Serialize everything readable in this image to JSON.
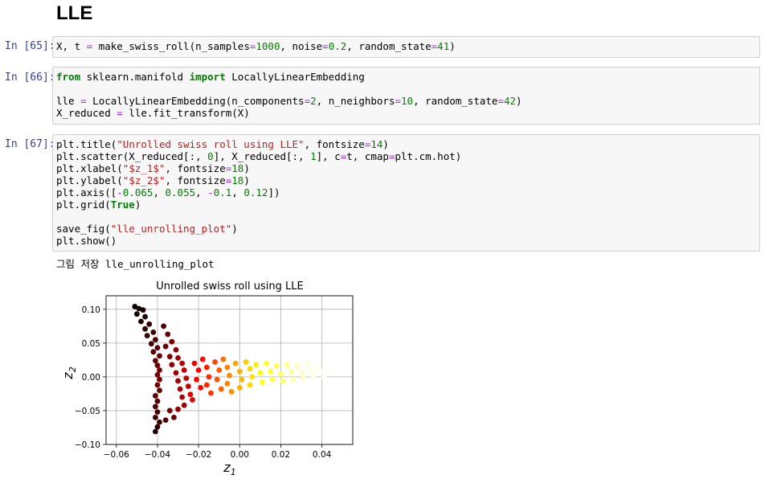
{
  "heading": "LLE",
  "cells": [
    {
      "prompt": "In [65]:",
      "lines": [
        [
          [
            "t",
            "X, t "
          ],
          [
            "op",
            "="
          ],
          [
            "t",
            " make_swiss_roll(n_samples"
          ],
          [
            "op",
            "="
          ],
          [
            "num",
            "1000"
          ],
          [
            "t",
            ", noise"
          ],
          [
            "op",
            "="
          ],
          [
            "num",
            "0.2"
          ],
          [
            "t",
            ", random_state"
          ],
          [
            "op",
            "="
          ],
          [
            "num",
            "41"
          ],
          [
            "t",
            ")"
          ]
        ]
      ]
    },
    {
      "prompt": "In [66]:",
      "lines": [
        [
          [
            "kw",
            "from"
          ],
          [
            "t",
            " sklearn.manifold "
          ],
          [
            "kw",
            "import"
          ],
          [
            "t",
            " LocallyLinearEmbedding"
          ]
        ],
        [],
        [
          [
            "t",
            "lle "
          ],
          [
            "op",
            "="
          ],
          [
            "t",
            " LocallyLinearEmbedding(n_components"
          ],
          [
            "op",
            "="
          ],
          [
            "num",
            "2"
          ],
          [
            "t",
            ", n_neighbors"
          ],
          [
            "op",
            "="
          ],
          [
            "num",
            "10"
          ],
          [
            "t",
            ", random_state"
          ],
          [
            "op",
            "="
          ],
          [
            "num",
            "42"
          ],
          [
            "t",
            ")"
          ]
        ],
        [
          [
            "t",
            "X_reduced "
          ],
          [
            "op",
            "="
          ],
          [
            "t",
            " lle.fit_transform(X)"
          ]
        ]
      ]
    },
    {
      "prompt": "In [67]:",
      "lines": [
        [
          [
            "t",
            "plt.title("
          ],
          [
            "str",
            "\"Unrolled swiss roll using LLE\""
          ],
          [
            "t",
            ", fontsize"
          ],
          [
            "op",
            "="
          ],
          [
            "num",
            "14"
          ],
          [
            "t",
            ")"
          ]
        ],
        [
          [
            "t",
            "plt.scatter(X_reduced[:, "
          ],
          [
            "num",
            "0"
          ],
          [
            "t",
            "], X_reduced[:, "
          ],
          [
            "num",
            "1"
          ],
          [
            "t",
            "], c"
          ],
          [
            "op",
            "="
          ],
          [
            "t",
            "t, cmap"
          ],
          [
            "op",
            "="
          ],
          [
            "t",
            "plt.cm.hot)"
          ]
        ],
        [
          [
            "t",
            "plt.xlabel("
          ],
          [
            "str",
            "\"$z_1$\""
          ],
          [
            "t",
            ", fontsize"
          ],
          [
            "op",
            "="
          ],
          [
            "num",
            "18"
          ],
          [
            "t",
            ")"
          ]
        ],
        [
          [
            "t",
            "plt.ylabel("
          ],
          [
            "str",
            "\"$z_2$\""
          ],
          [
            "t",
            ", fontsize"
          ],
          [
            "op",
            "="
          ],
          [
            "num",
            "18"
          ],
          [
            "t",
            ")"
          ]
        ],
        [
          [
            "t",
            "plt.axis(["
          ],
          [
            "op",
            "-"
          ],
          [
            "num",
            "0.065"
          ],
          [
            "t",
            ", "
          ],
          [
            "num",
            "0.055"
          ],
          [
            "t",
            ", "
          ],
          [
            "op",
            "-"
          ],
          [
            "num",
            "0.1"
          ],
          [
            "t",
            ", "
          ],
          [
            "num",
            "0.12"
          ],
          [
            "t",
            "])"
          ]
        ],
        [
          [
            "t",
            "plt.grid("
          ],
          [
            "kw",
            "True"
          ],
          [
            "t",
            ")"
          ]
        ],
        [],
        [
          [
            "t",
            "save_fig("
          ],
          [
            "str",
            "\"lle_unrolling_plot\""
          ],
          [
            "t",
            ")"
          ]
        ],
        [
          [
            "t",
            "plt.show()"
          ]
        ]
      ]
    }
  ],
  "stdout": "그림 저장 lle_unrolling_plot",
  "chart_data": {
    "type": "scatter",
    "title": "Unrolled swiss roll using LLE",
    "xlabel": "z1",
    "ylabel": "z2",
    "xlim": [
      -0.065,
      0.055
    ],
    "ylim": [
      -0.1,
      0.12
    ],
    "xticks": [
      -0.06,
      -0.04,
      -0.02,
      0.0,
      0.02,
      0.04
    ],
    "xtick_labels": [
      "−0.06",
      "−0.04",
      "−0.02",
      "0.00",
      "0.02",
      "0.04"
    ],
    "yticks": [
      0.1,
      0.05,
      0.0,
      -0.05,
      -0.1
    ],
    "ytick_labels": [
      "0.10",
      "0.05",
      "0.00",
      "−0.05",
      "−0.10"
    ],
    "grid": true,
    "colormap": "hot",
    "points": [
      [
        -0.051,
        0.104,
        0.0
      ],
      [
        -0.049,
        0.101,
        0.01
      ],
      [
        -0.047,
        0.099,
        0.02
      ],
      [
        -0.05,
        0.093,
        0.01
      ],
      [
        -0.046,
        0.089,
        0.03
      ],
      [
        -0.048,
        0.082,
        0.03
      ],
      [
        -0.044,
        0.078,
        0.05
      ],
      [
        -0.046,
        0.071,
        0.05
      ],
      [
        -0.042,
        0.066,
        0.07
      ],
      [
        -0.045,
        0.061,
        0.06
      ],
      [
        -0.041,
        0.055,
        0.09
      ],
      [
        -0.043,
        0.049,
        0.09
      ],
      [
        -0.04,
        0.043,
        0.11
      ],
      [
        -0.042,
        0.037,
        0.11
      ],
      [
        -0.039,
        0.031,
        0.13
      ],
      [
        -0.041,
        0.024,
        0.13
      ],
      [
        -0.04,
        0.017,
        0.14
      ],
      [
        -0.039,
        0.01,
        0.15
      ],
      [
        -0.04,
        0.003,
        0.15
      ],
      [
        -0.039,
        -0.004,
        0.15
      ],
      [
        -0.04,
        -0.012,
        0.14
      ],
      [
        -0.039,
        -0.02,
        0.13
      ],
      [
        -0.041,
        -0.028,
        0.12
      ],
      [
        -0.04,
        -0.036,
        0.11
      ],
      [
        -0.041,
        -0.044,
        0.1
      ],
      [
        -0.04,
        -0.052,
        0.09
      ],
      [
        -0.041,
        -0.06,
        0.07
      ],
      [
        -0.039,
        -0.067,
        0.06
      ],
      [
        -0.04,
        -0.074,
        0.05
      ],
      [
        -0.041,
        -0.081,
        0.03
      ],
      [
        -0.037,
        0.075,
        0.1
      ],
      [
        -0.035,
        0.063,
        0.13
      ],
      [
        -0.033,
        0.052,
        0.16
      ],
      [
        -0.036,
        0.045,
        0.14
      ],
      [
        -0.031,
        0.04,
        0.19
      ],
      [
        -0.034,
        0.03,
        0.17
      ],
      [
        -0.03,
        0.028,
        0.21
      ],
      [
        -0.033,
        0.018,
        0.19
      ],
      [
        -0.028,
        0.02,
        0.24
      ],
      [
        -0.031,
        0.006,
        0.21
      ],
      [
        -0.027,
        0.01,
        0.26
      ],
      [
        -0.03,
        -0.006,
        0.22
      ],
      [
        -0.026,
        -0.002,
        0.27
      ],
      [
        -0.029,
        -0.018,
        0.24
      ],
      [
        -0.025,
        -0.014,
        0.28
      ],
      [
        -0.028,
        -0.03,
        0.23
      ],
      [
        -0.024,
        -0.026,
        0.3
      ],
      [
        -0.027,
        -0.042,
        0.22
      ],
      [
        -0.034,
        -0.05,
        0.15
      ],
      [
        -0.032,
        -0.06,
        0.14
      ],
      [
        -0.036,
        -0.064,
        0.1
      ],
      [
        -0.03,
        -0.048,
        0.19
      ],
      [
        -0.022,
        0.02,
        0.33
      ],
      [
        -0.02,
        0.01,
        0.36
      ],
      [
        -0.021,
        -0.004,
        0.35
      ],
      [
        -0.019,
        -0.016,
        0.37
      ],
      [
        -0.023,
        -0.034,
        0.31
      ],
      [
        -0.018,
        0.026,
        0.38
      ],
      [
        -0.016,
        0.014,
        0.41
      ],
      [
        -0.015,
        0.0,
        0.43
      ],
      [
        -0.016,
        -0.012,
        0.42
      ],
      [
        -0.014,
        -0.024,
        0.44
      ],
      [
        -0.012,
        0.022,
        0.47
      ],
      [
        -0.01,
        0.01,
        0.5
      ],
      [
        -0.011,
        -0.004,
        0.49
      ],
      [
        -0.009,
        -0.018,
        0.51
      ],
      [
        -0.008,
        0.026,
        0.53
      ],
      [
        -0.006,
        0.014,
        0.56
      ],
      [
        -0.005,
        0.002,
        0.57
      ],
      [
        -0.006,
        -0.01,
        0.56
      ],
      [
        -0.004,
        -0.022,
        0.58
      ],
      [
        -0.002,
        0.02,
        0.61
      ],
      [
        0.0,
        0.008,
        0.63
      ],
      [
        0.001,
        -0.004,
        0.64
      ],
      [
        0.0,
        -0.016,
        0.63
      ],
      [
        0.003,
        0.022,
        0.67
      ],
      [
        0.005,
        0.012,
        0.69
      ],
      [
        0.006,
        0.0,
        0.7
      ],
      [
        0.005,
        -0.012,
        0.69
      ],
      [
        0.008,
        0.018,
        0.72
      ],
      [
        0.01,
        0.006,
        0.75
      ],
      [
        0.011,
        -0.008,
        0.76
      ],
      [
        0.013,
        0.02,
        0.78
      ],
      [
        0.015,
        0.008,
        0.8
      ],
      [
        0.016,
        -0.004,
        0.81
      ],
      [
        0.018,
        0.016,
        0.83
      ],
      [
        0.02,
        0.004,
        0.85
      ],
      [
        0.021,
        -0.006,
        0.86
      ],
      [
        0.023,
        0.018,
        0.88
      ],
      [
        0.025,
        0.008,
        0.9
      ],
      [
        0.026,
        -0.004,
        0.91
      ],
      [
        0.028,
        0.016,
        0.93
      ],
      [
        0.03,
        0.006,
        0.94
      ],
      [
        0.031,
        -0.002,
        0.95
      ],
      [
        0.033,
        0.018,
        0.96
      ],
      [
        0.035,
        0.008,
        0.97
      ],
      [
        0.036,
        0.0,
        0.97
      ],
      [
        0.038,
        0.016,
        0.98
      ],
      [
        0.04,
        0.008,
        0.98
      ],
      [
        0.041,
        0.0,
        0.99
      ],
      [
        0.043,
        0.014,
        0.99
      ],
      [
        0.045,
        0.006,
        0.99
      ],
      [
        0.046,
        0.018,
        1.0
      ],
      [
        0.048,
        0.008,
        1.0
      ],
      [
        0.05,
        0.014,
        1.0
      ],
      [
        0.052,
        0.006,
        1.0
      ],
      [
        0.053,
        0.02,
        1.0
      ],
      [
        0.054,
        0.01,
        1.0
      ]
    ]
  }
}
